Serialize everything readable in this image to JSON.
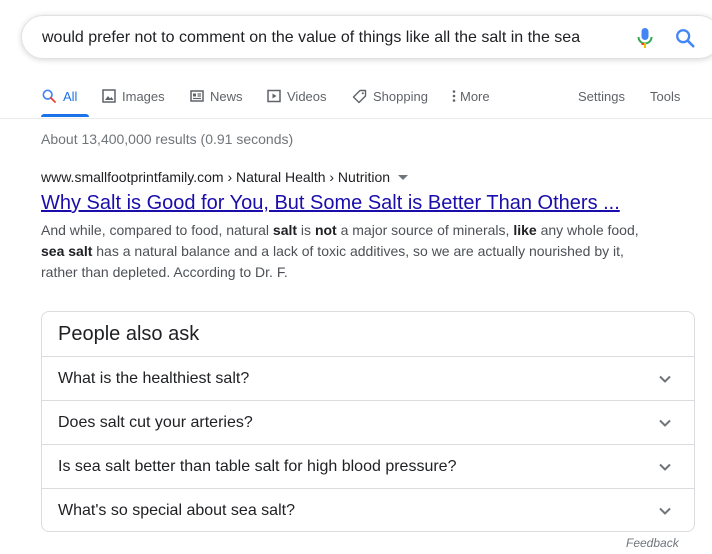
{
  "search": {
    "query": "would prefer not to comment on the value of things like all the salt in the sea"
  },
  "tabs": [
    {
      "label": "All",
      "icon": "search-icon"
    },
    {
      "label": "Images",
      "icon": "image-icon"
    },
    {
      "label": "News",
      "icon": "news-icon"
    },
    {
      "label": "Videos",
      "icon": "video-icon"
    },
    {
      "label": "Shopping",
      "icon": "tag-icon"
    },
    {
      "label": "More",
      "icon": "more-vert-icon"
    }
  ],
  "tools": {
    "settings": "Settings",
    "tools": "Tools"
  },
  "stats": "About 13,400,000 results (0.91 seconds)",
  "result": {
    "cite": "www.smallfootprintfamily.com › Natural Health › Nutrition",
    "title": "Why Salt is Good for You, But Some Salt is Better Than Others ...",
    "snippet": {
      "s1": "And while, compared to food, natural ",
      "b1": "salt",
      "s2": " is ",
      "b2": "not",
      "s3": " a major source of minerals, ",
      "b3": "like",
      "s4": " any whole food, ",
      "b4": "sea salt",
      "s5": " has a natural balance and a lack of toxic additives, so we are actually nourished by it, rather than depleted. According to Dr. F."
    }
  },
  "paa": {
    "title": "People also ask",
    "questions": [
      "What is the healthiest salt?",
      "Does salt cut your arteries?",
      "Is sea salt better than table salt for high blood pressure?",
      "What's so special about sea salt?"
    ]
  },
  "feedback": "Feedback",
  "colors": {
    "link": "#1a0dab",
    "accent": "#1a73e8"
  }
}
